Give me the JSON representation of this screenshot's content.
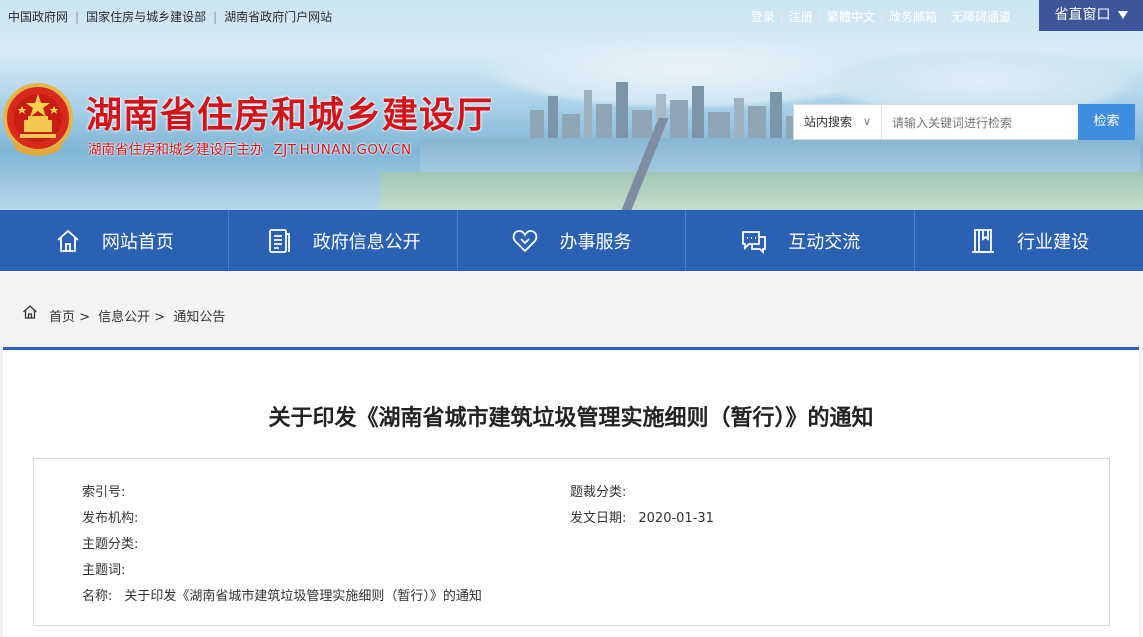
{
  "topbar": {
    "links": [
      "中国政府网",
      "国家住房与城乡建设部",
      "湖南省政府门户网站"
    ],
    "right_links": [
      "登录",
      "注册",
      "繁體中文",
      "政务邮箱",
      "无障碍通道"
    ],
    "window_button": "省直窗口"
  },
  "header": {
    "title": "湖南省住房和城乡建设厅",
    "subtitle": "湖南省住房和城乡建设厅主办",
    "domain": "ZJT.HUNAN.GOV.CN"
  },
  "search": {
    "scope": "站内搜索",
    "scope_chevron": "∨",
    "placeholder": "请输入关键词进行检索",
    "button": "检索"
  },
  "nav": {
    "items": [
      {
        "label": "网站首页",
        "icon": "home-icon"
      },
      {
        "label": "政府信息公开",
        "icon": "document-icon"
      },
      {
        "label": "办事服务",
        "icon": "heart-icon"
      },
      {
        "label": "互动交流",
        "icon": "chat-icon"
      },
      {
        "label": "行业建设",
        "icon": "book-icon"
      }
    ]
  },
  "breadcrumb": {
    "items": [
      "首页 >",
      "信息公开 >",
      "通知公告"
    ]
  },
  "document": {
    "title": "关于印发《湖南省城市建筑垃圾管理实施细则（暂行）》的通知",
    "meta": {
      "index_label": "索引号:",
      "index_value": "",
      "category_label": "题裁分类:",
      "category_value": "",
      "publisher_label": "发布机构:",
      "publisher_value": "",
      "date_label": "发文日期:",
      "date_value": "2020-01-31",
      "topic_label": "主题分类:",
      "topic_value": "",
      "keywords_label": "主题词:",
      "keywords_value": "",
      "name_label": "名称:",
      "name_value": "关于印发《湖南省城市建筑垃圾管理实施细则（暂行）》的通知"
    }
  },
  "colors": {
    "nav_bg": "#2a61b4",
    "title_red": "#d4141b",
    "search_button": "#3e8de0",
    "window_button": "#3d5599"
  }
}
